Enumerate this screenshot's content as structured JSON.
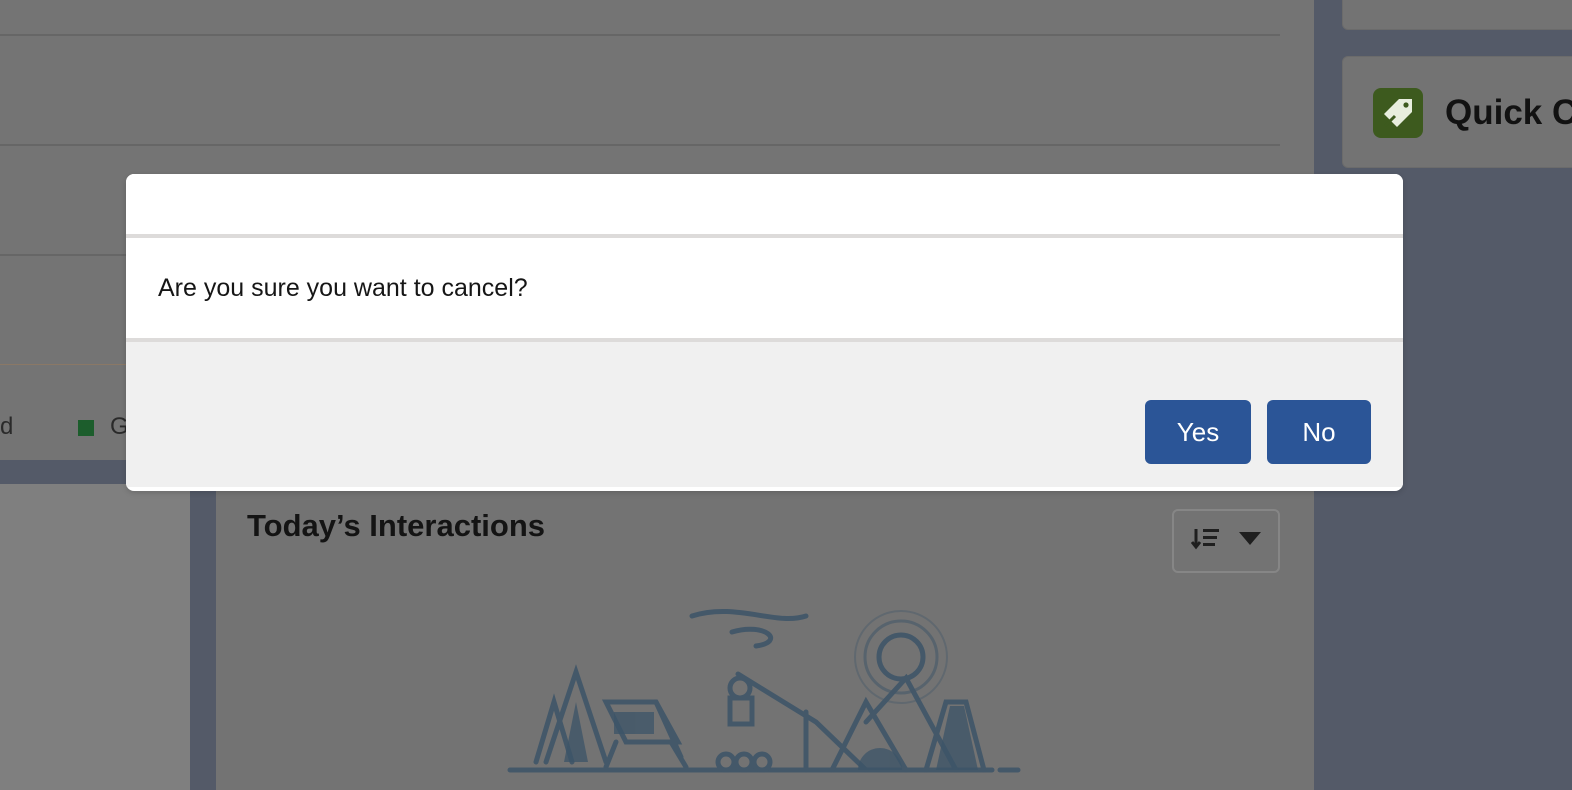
{
  "background": {
    "legend_fragment_1": "d",
    "legend_fragment_2": "G",
    "interactions_title": "Today’s Interactions",
    "quick_card_title": "Quick Cr",
    "icons": {
      "sort": "sort-list-icon",
      "dropdown": "chevron-down-icon",
      "quick_create": "tag-icon",
      "empty_state": "camping-illustration"
    }
  },
  "dialog": {
    "title": "",
    "message": "Are you sure you want to cancel?",
    "yes_label": "Yes",
    "no_label": "No",
    "button_color": "#2b5597"
  }
}
